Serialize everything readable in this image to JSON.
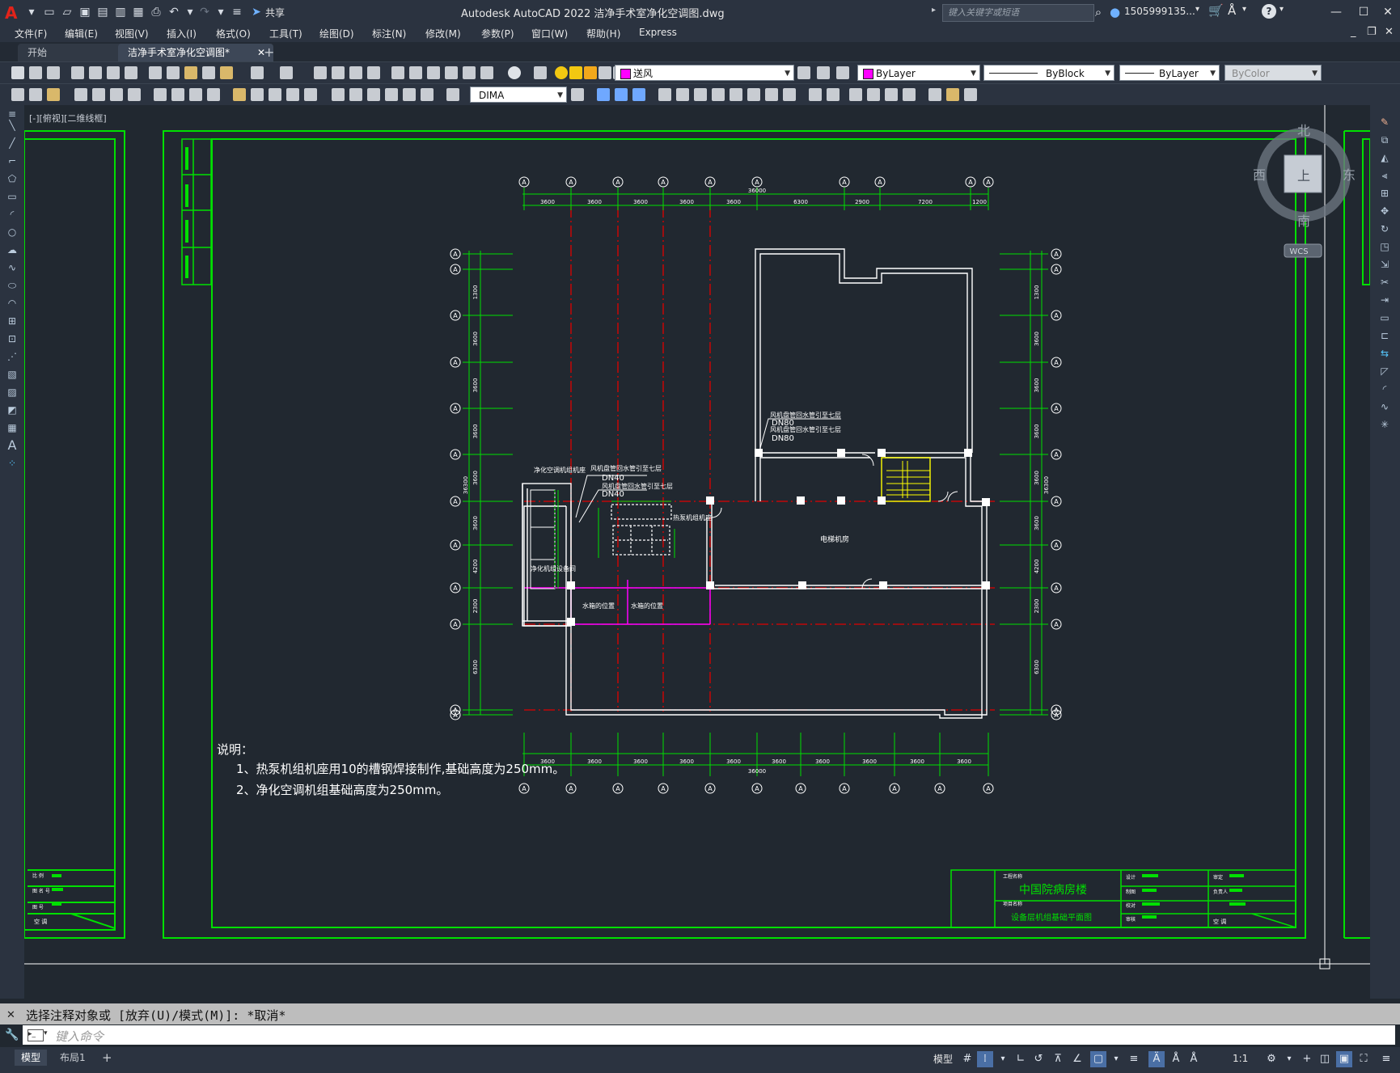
{
  "app": {
    "title": "Autodesk AutoCAD 2022    洁净手术室净化空调图.dwg",
    "share_label": "共享",
    "search_placeholder": "键入关键字或短语",
    "user_name": "1505999135...",
    "logo_letter": "A"
  },
  "menu": [
    "文件(F)",
    "编辑(E)",
    "视图(V)",
    "插入(I)",
    "格式(O)",
    "工具(T)",
    "绘图(D)",
    "标注(N)",
    "修改(M)",
    "参数(P)",
    "窗口(W)",
    "帮助(H)",
    "Express"
  ],
  "tabs": [
    {
      "label": "开始",
      "active": false
    },
    {
      "label": "洁净手术室净化空调图*",
      "active": true
    }
  ],
  "toolbar": {
    "layer_value": "送风",
    "layer_color": "#ff00ff",
    "color_value": "ByLayer",
    "linetype_value": "ByBlock",
    "lineweight_value": "ByLayer",
    "plotstyle_value": "ByColor",
    "dimstyle_value": "DIMA"
  },
  "viewport_label": "[-][俯视][二维线框]",
  "viewcube": {
    "north": "北",
    "south": "南",
    "east": "东",
    "west": "西",
    "top": "上",
    "wcs": "WCS"
  },
  "drawing": {
    "notes_title": "说明：",
    "note_1": "1、热泵机组机座用10的槽钢焊接制作,基础高度为250mm。",
    "note_2": "2、净化空调机组基础高度为250mm。",
    "room_1": "电梯机房",
    "room_2": "净化机组设备间",
    "room_3": "水箱的位置",
    "room_4": "水箱的位置",
    "label_purify": "净化空调机组机座",
    "label_pipe_1": "风机盘管回水管引至七层",
    "label_pipe_2": "风机盘管回水管引至七层",
    "label_pipe_3": "风机盘管回水管引至七层",
    "label_pipe_4": "风机盘管回水管引至七层",
    "label_heatpump": "热泵机组机座",
    "dn_1": "DN40",
    "dn_2": "DN40",
    "dn_3": "DN80",
    "dn_4": "DN80",
    "axis_bubble": "A",
    "dims_top": [
      "3600",
      "3600",
      "3600",
      "3600",
      "3600",
      "6300",
      "2900",
      "7200",
      "1200"
    ],
    "dim_top_total": "36000",
    "dims_bottom": [
      "3600",
      "3600",
      "3600",
      "3600",
      "3600",
      "3600",
      "3600",
      "3600",
      "3600",
      "3600"
    ],
    "dim_bottom_total": "36000",
    "dims_left": [
      "1300",
      "3600",
      "3600",
      "3600",
      "3600",
      "3600",
      "4200",
      "2300",
      "6300"
    ],
    "dim_left_total": "36300",
    "dims_right": [
      "1300",
      "3600",
      "3600",
      "3600",
      "3600",
      "3600",
      "4200",
      "2300",
      "6300"
    ],
    "dim_right_total": "36300",
    "title_block_project": "中国院病房楼",
    "title_block_drawing": "设备层机组基础平面图",
    "title_block_left_1": "工程名称",
    "title_block_left_2": "项目名称",
    "title_block_row_label": "空  调",
    "title_block_right_1": "设计",
    "title_block_right_2": "制图",
    "title_block_right_3": "校对",
    "title_block_right_4": "审核",
    "title_block_far_1": "审定",
    "title_block_far_2": "负责人",
    "title_block_far_3": "空  调",
    "left_sheet_1": "比  例",
    "left_sheet_2": "图 名 号",
    "left_sheet_3": "图  号",
    "left_sheet_4": "空  调"
  },
  "command": {
    "history": "选择注释对象或 [放弃(U)/模式(M)]: *取消*",
    "placeholder": "键入命令"
  },
  "status": {
    "tab_model": "模型",
    "tab_layout": "布局1",
    "model_label": "模型",
    "scale": "1:1"
  }
}
